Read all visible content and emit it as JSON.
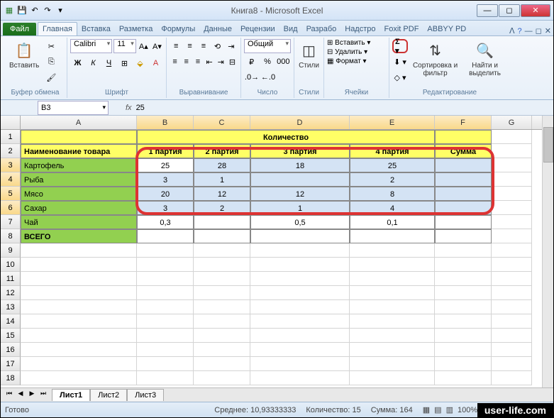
{
  "app": {
    "title": "Книга8 - Microsoft Excel"
  },
  "tabs": {
    "file": "Файл",
    "items": [
      "Главная",
      "Вставка",
      "Разметка",
      "Формулы",
      "Данные",
      "Рецензии",
      "Вид",
      "Разрабо",
      "Надстро",
      "Foxit PDF",
      "ABBYY PD"
    ],
    "active": 0
  },
  "ribbon": {
    "clipboard": {
      "label": "Буфер обмена",
      "paste": "Вставить"
    },
    "font": {
      "label": "Шрифт",
      "name": "Calibri",
      "size": "11"
    },
    "alignment": {
      "label": "Выравнивание"
    },
    "number": {
      "label": "Число",
      "format": "Общий"
    },
    "styles": {
      "label": "Стили",
      "btn": "Стили"
    },
    "cells": {
      "label": "Ячейки",
      "insert": "Вставить",
      "delete": "Удалить",
      "format": "Формат"
    },
    "editing": {
      "label": "Редактирование",
      "sort": "Сортировка и фильтр",
      "find": "Найти и выделить"
    }
  },
  "formula": {
    "nameBox": "B3",
    "value": "25"
  },
  "columns": [
    "A",
    "B",
    "C",
    "D",
    "E",
    "F",
    "G"
  ],
  "rows": [
    "1",
    "2",
    "3",
    "4",
    "5",
    "6",
    "7",
    "8",
    "9",
    "10",
    "11",
    "12",
    "13",
    "14",
    "15",
    "16",
    "17",
    "18"
  ],
  "headers": {
    "itemName": "Наименование товара",
    "quantity": "Количество",
    "batch1": "1 партия",
    "batch2": "2 партия",
    "batch3": "3 партия",
    "batch4": "4 партия",
    "sum": "Сумма"
  },
  "items": {
    "r3": {
      "name": "Картофель",
      "b": "25",
      "c": "28",
      "d": "18",
      "e": "25"
    },
    "r4": {
      "name": "Рыба",
      "b": "3",
      "c": "1",
      "d": "",
      "e": "2"
    },
    "r5": {
      "name": "Мясо",
      "b": "20",
      "c": "12",
      "d": "12",
      "e": "8"
    },
    "r6": {
      "name": "Сахар",
      "b": "3",
      "c": "2",
      "d": "1",
      "e": "4"
    },
    "r7": {
      "name": "Чай",
      "b": "0,3",
      "c": "",
      "d": "0,5",
      "e": "0,1"
    },
    "r8": {
      "name": "ВСЕГО"
    }
  },
  "sheets": {
    "s1": "Лист1",
    "s2": "Лист2",
    "s3": "Лист3"
  },
  "status": {
    "ready": "Готово",
    "avg": "Среднее: 10,93333333",
    "count": "Количество: 15",
    "sum": "Сумма: 164",
    "zoom": "100%"
  },
  "watermark": "user-life.com",
  "chart_data": {
    "type": "table",
    "title": "Количество",
    "columns": [
      "Наименование товара",
      "1 партия",
      "2 партия",
      "3 партия",
      "4 партия",
      "Сумма"
    ],
    "rows": [
      [
        "Картофель",
        25,
        28,
        18,
        25,
        null
      ],
      [
        "Рыба",
        3,
        1,
        null,
        2,
        null
      ],
      [
        "Мясо",
        20,
        12,
        12,
        8,
        null
      ],
      [
        "Сахар",
        3,
        2,
        1,
        4,
        null
      ],
      [
        "Чай",
        0.3,
        null,
        0.5,
        0.1,
        null
      ],
      [
        "ВСЕГО",
        null,
        null,
        null,
        null,
        null
      ]
    ]
  }
}
